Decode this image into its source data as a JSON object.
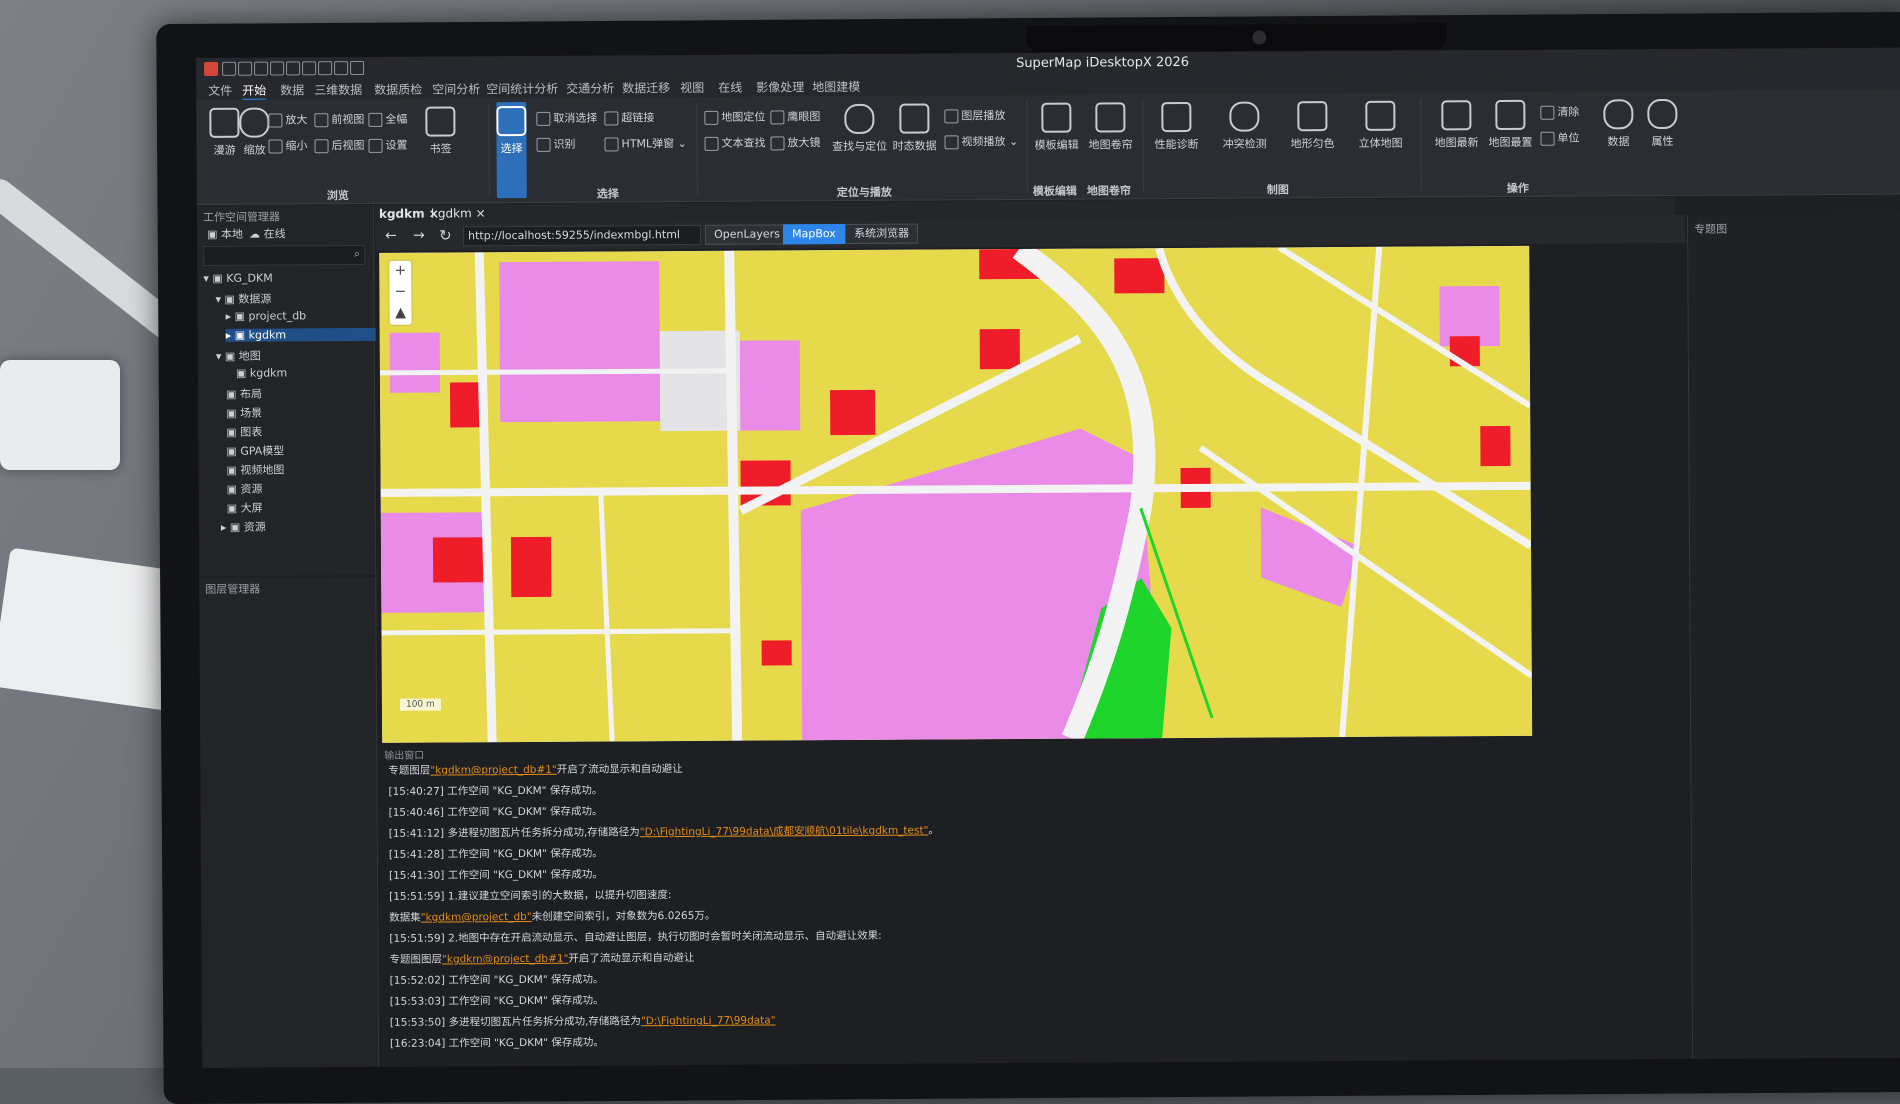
{
  "window": {
    "title": "SuperMap iDesktopX 2026"
  },
  "menu": [
    "文件",
    "开始",
    "数据",
    "三维数据",
    "数据质检",
    "空间分析",
    "空间统计分析",
    "交通分析",
    "数据迁移",
    "视图",
    "在线",
    "影像处理",
    "地图建模"
  ],
  "menu_active": "开始",
  "ribbon": {
    "browse": {
      "pan": "漫游",
      "zoom": "缩放",
      "zoom_in": "放大",
      "zoom_out": "缩小",
      "prev_view": "前视图",
      "next_view": "后视图",
      "full": "全幅",
      "settings": "设置",
      "bookmark": "书签",
      "group": "浏览"
    },
    "select": {
      "select": "选择",
      "cancel_select": "取消选择",
      "clear_select": "超链接",
      "identify": "识别",
      "html_popup": "HTML弹窗",
      "group": "选择"
    },
    "locate": {
      "map_locate": "地图定位",
      "text_search": "文本查找",
      "hawkeye": "鹰眼图",
      "magnifier": "放大镜",
      "find_locate": "查找与定位",
      "temporal": "时态数据",
      "layer_play": "图层播放",
      "video_play": "视频播放",
      "group": "定位与播放"
    },
    "template": {
      "template_edit": "模板编辑",
      "map_roll": "地图卷帘",
      "group1": "模板编辑",
      "group2": "地图卷帘"
    },
    "mapping": {
      "perf": "性能诊断",
      "conflict": "冲突检测",
      "terrain": "地形匀色",
      "stereo": "立体地图",
      "group": "制图"
    },
    "ops": {
      "layer_map": "地图最新",
      "map_top": "地图最置",
      "clear": "清除",
      "unit": "单位",
      "group": "操作"
    },
    "data": "数据",
    "props": "属性"
  },
  "workspace": {
    "title": "工作空间管理器",
    "tabs": [
      "本地",
      "在线"
    ],
    "tree": [
      "KG_DKM",
      "数据源",
      "project_db",
      "kgdkm",
      "地图",
      "kgdkm",
      "布局",
      "场景",
      "图表",
      "GPA模型",
      "视频地图",
      "资源",
      "大屏",
      "资源"
    ]
  },
  "layer_manager": {
    "title": "图层管理器"
  },
  "doc_tabs": [
    "kgdkm ×",
    "kgdkm ×"
  ],
  "browser": {
    "url": "http://localhost:59255/indexmbgl.html",
    "engines": [
      "OpenLayers",
      "MapBox",
      "系统浏览器"
    ],
    "active_engine": "MapBox"
  },
  "right_panel": {
    "title": "专题图"
  },
  "map": {
    "scale": "100 m",
    "zoom_in": "+",
    "zoom_out": "−",
    "compass": "▲"
  },
  "output": {
    "title": "输出窗口",
    "lines": [
      {
        "pre": "专题图层",
        "link": "\"kgdkm@project_db#1\"",
        "post": "开启了流动显示和自动避让"
      },
      {
        "pre": "[15:40:27] 工作空间 \"KG_DKM\" 保存成功。",
        "link": "",
        "post": ""
      },
      {
        "pre": "[15:40:46] 工作空间 \"KG_DKM\" 保存成功。",
        "link": "",
        "post": ""
      },
      {
        "pre": "[15:41:12] 多进程切图瓦片任务拆分成功,存储路径为",
        "link": "\"D:\\FightingLi_77\\99data\\成都安顺航\\01tile\\kgdkm_test\"",
        "post": "。"
      },
      {
        "pre": "[15:41:28] 工作空间 \"KG_DKM\" 保存成功。",
        "link": "",
        "post": ""
      },
      {
        "pre": "[15:41:30] 工作空间 \"KG_DKM\" 保存成功。",
        "link": "",
        "post": ""
      },
      {
        "pre": "[15:51:59] 1.建议建立空间索引的大数据，以提升切图速度:",
        "link": "",
        "post": ""
      },
      {
        "pre": "数据集",
        "link": "\"kgdkm@project_db\"",
        "post": "未创建空间索引，对象数为6.0265万。"
      },
      {
        "pre": "[15:51:59] 2.地图中存在开启流动显示、自动避让图层，执行切图时会暂时关闭流动显示、自动避让效果:",
        "link": "",
        "post": ""
      },
      {
        "pre": "专题图图层",
        "link": "\"kgdkm@project_db#1\"",
        "post": "开启了流动显示和自动避让"
      },
      {
        "pre": "[15:52:02] 工作空间 \"KG_DKM\" 保存成功。",
        "link": "",
        "post": ""
      },
      {
        "pre": "[15:53:03] 工作空间 \"KG_DKM\" 保存成功。",
        "link": "",
        "post": ""
      },
      {
        "pre": "[15:53:50] 多进程切图瓦片任务拆分成功,存储路径为",
        "link": "\"D:\\FightingLi_77\\99data\"",
        "post": ""
      },
      {
        "pre": "[16:23:04] 工作空间 \"KG_DKM\" 保存成功。",
        "link": "",
        "post": ""
      }
    ]
  },
  "colors": {
    "accent": "#2d86e8",
    "yellow": "#e6d84a",
    "magenta": "#e889e8",
    "red": "#f01e2c",
    "green": "#21d42b",
    "road": "#f2f2f2"
  }
}
